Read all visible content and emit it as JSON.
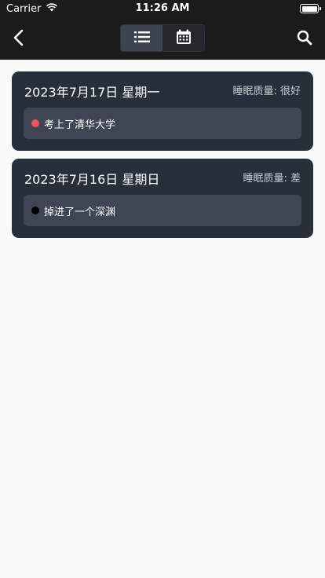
{
  "status_bar": {
    "carrier": "Carrier",
    "time": "11:26 AM",
    "wifi_icon": "wifi-icon",
    "battery_icon": "battery-icon"
  },
  "nav": {
    "back_icon": "chevron-left-icon",
    "search_icon": "search-icon",
    "segments": [
      {
        "icon": "list-icon",
        "active": true
      },
      {
        "icon": "calendar-icon",
        "active": false
      }
    ]
  },
  "entries": [
    {
      "date": "2023年7月17日 星期一",
      "quality": "睡眠质量: 很好",
      "dream": "考上了清华大学",
      "dot_color": "#f0555a"
    },
    {
      "date": "2023年7月16日 星期日",
      "quality": "睡眠质量: 差",
      "dream": "掉进了一个深渊",
      "dot_color": "#000000"
    }
  ],
  "colors": {
    "nav_bg": "#1b1b1b",
    "card_bg": "#27303a",
    "dream_bg": "#3d4652",
    "page_bg": "#f9f9f9"
  }
}
